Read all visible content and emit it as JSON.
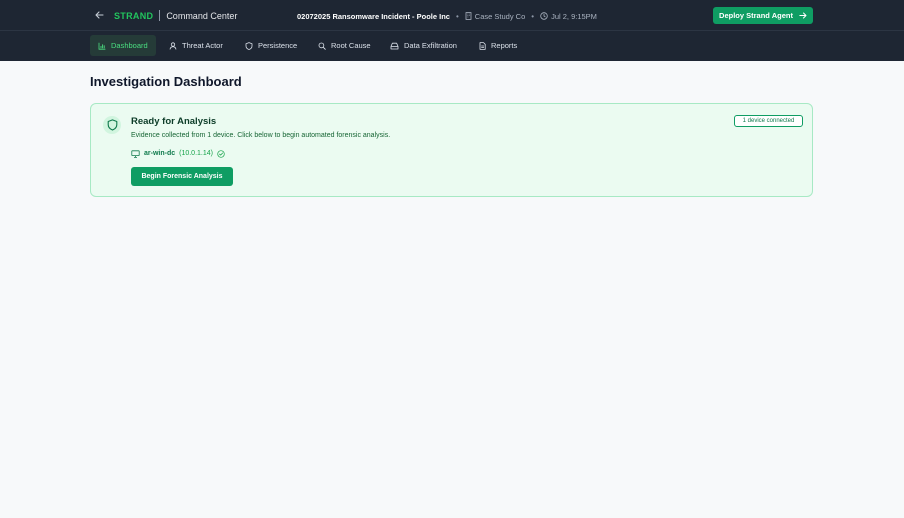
{
  "header": {
    "brand": "STRAND",
    "subtitle": "Command Center",
    "incident_title": "02072025 Ransomware Incident - Poole Inc",
    "company": "Case Study Co",
    "timestamp": "Jul 2, 9:15PM",
    "deploy_label": "Deploy Strand Agent"
  },
  "nav": {
    "items": [
      {
        "label": "Dashboard",
        "icon": "bar-chart-icon",
        "active": true
      },
      {
        "label": "Threat Actor",
        "icon": "user-icon"
      },
      {
        "label": "Persistence",
        "icon": "shield-icon"
      },
      {
        "label": "Root Cause",
        "icon": "search-icon"
      },
      {
        "label": "Data Exfiltration",
        "icon": "drive-icon"
      },
      {
        "label": "Reports",
        "icon": "document-icon"
      }
    ]
  },
  "main": {
    "title": "Investigation Dashboard",
    "card": {
      "title": "Ready for Analysis",
      "description": "Evidence collected from 1 device. Click below to begin automated forensic analysis.",
      "device_name": "ar-win-dc",
      "device_ip": "(10.0.1.14)",
      "button_label": "Begin Forensic Analysis",
      "badge": "1 device connected"
    }
  },
  "colors": {
    "topbar_bg": "#1e2633",
    "accent_green": "#0f9d63",
    "brand_green": "#22c55e",
    "card_bg": "#ebfbf1",
    "card_border": "#a7e9c4"
  }
}
